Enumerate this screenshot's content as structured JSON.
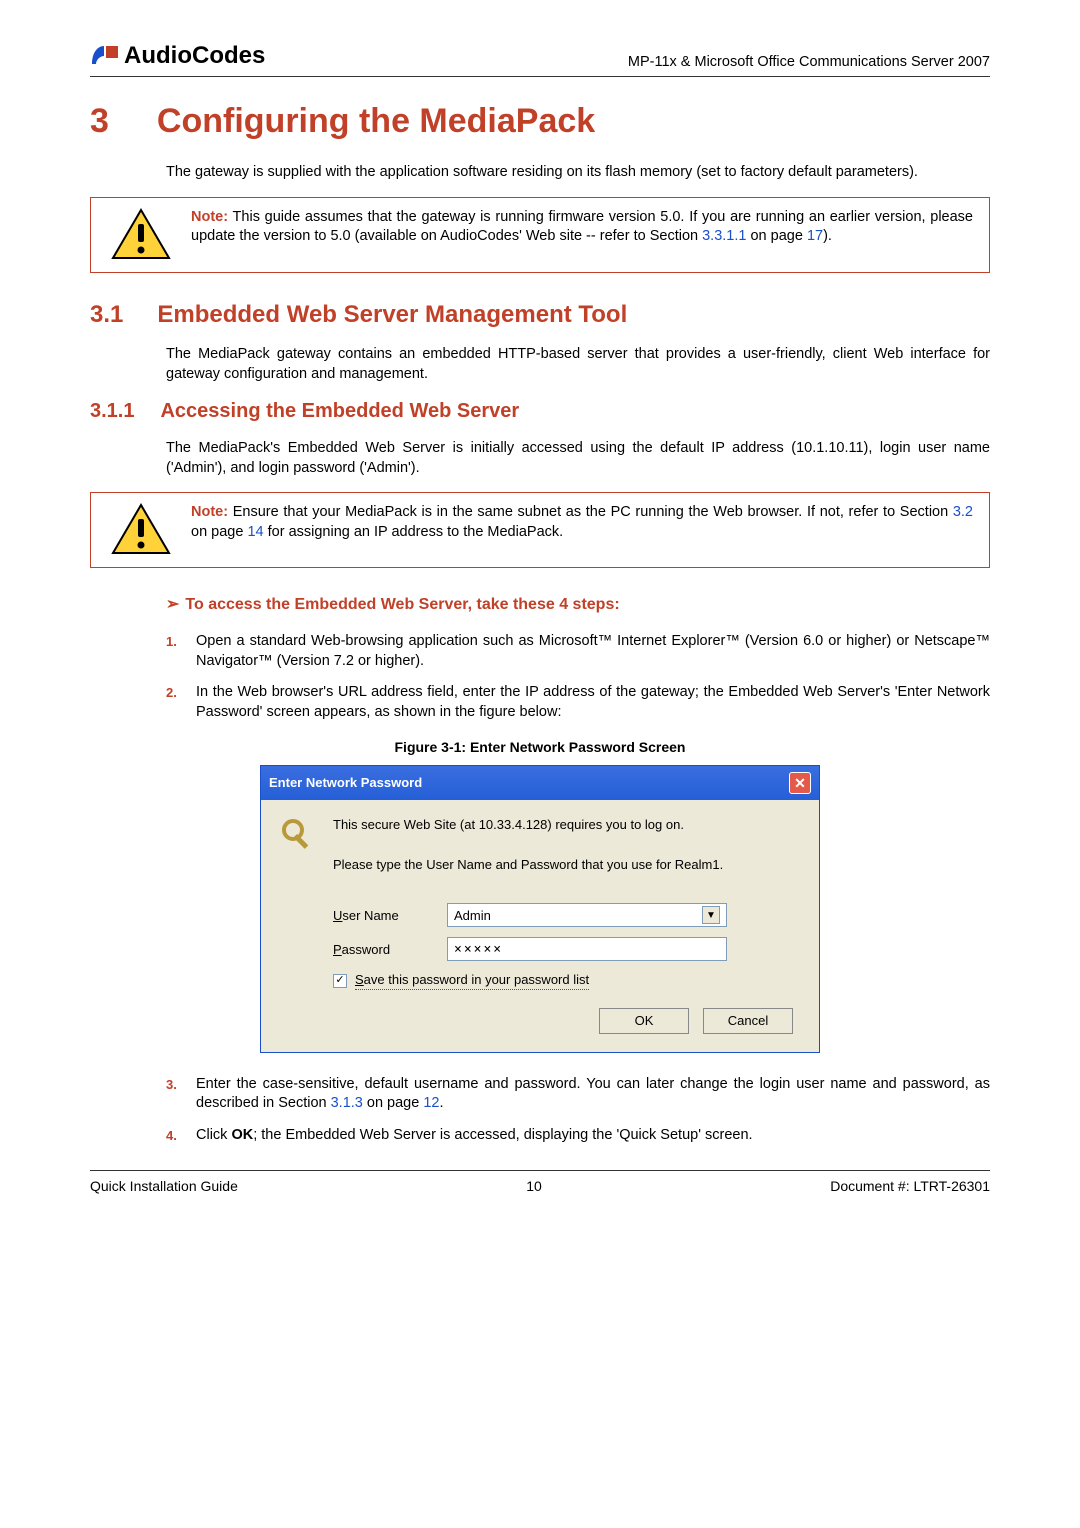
{
  "header": {
    "brand_prefix": "Audio",
    "brand_suffix": "Codes",
    "right": "MP-11x & Microsoft Office Communications Server 2007"
  },
  "h1": {
    "num": "3",
    "title": "Configuring the MediaPack"
  },
  "intro": "The gateway is supplied with the application software residing on its flash memory (set to factory default parameters).",
  "note1": {
    "label": "Note:",
    "text_a": "This guide assumes that the gateway is running firmware version 5.0. If you are running an earlier version, please update the version to 5.0 (available on AudioCodes' Web site -- refer to Section ",
    "ref1": "3.3.1.1",
    "text_b": " on page ",
    "ref2": "17",
    "text_c": ")."
  },
  "h2": {
    "num": "3.1",
    "title": "Embedded Web Server Management Tool"
  },
  "p2": "The MediaPack gateway contains an embedded HTTP-based server that provides a user-friendly, client Web interface for gateway configuration and management.",
  "h3": {
    "num": "3.1.1",
    "title": "Accessing the Embedded Web Server"
  },
  "p3": "The MediaPack's Embedded Web Server is initially accessed using the default IP address (10.1.10.11), login user name ('Admin'), and login password ('Admin').",
  "note2": {
    "label": "Note:",
    "text_a": "Ensure that your MediaPack is in the same subnet as the PC running the Web browser. If not, refer to Section ",
    "ref1": "3.2",
    "text_b": " on page ",
    "ref2": "14",
    "text_c": " for assigning an IP address to the MediaPack."
  },
  "proc_title": "To access the Embedded Web Server, take these 4 steps:",
  "steps": {
    "s1": "Open a standard Web-browsing application such as Microsoft™ Internet Explorer™ (Version 6.0 or higher) or Netscape™ Navigator™ (Version 7.2 or higher).",
    "s2": "In the Web browser's URL address field, enter the IP address of the gateway; the Embedded Web Server's 'Enter Network Password' screen appears, as shown in the figure below:",
    "s3_a": "Enter the case-sensitive, default username and password. You can later change the login user name and password, as described in Section ",
    "s3_ref1": "3.1.3",
    "s3_b": " on page ",
    "s3_ref2": "12",
    "s3_c": ".",
    "s4_a": "Click ",
    "s4_bold": "OK",
    "s4_b": "; the Embedded Web Server is accessed, displaying the 'Quick Setup' screen."
  },
  "figure_caption": "Figure 3-1: Enter Network Password Screen",
  "dialog": {
    "title": "Enter Network Password",
    "msg1": "This secure Web Site (at 10.33.4.128) requires you to log on.",
    "msg2": "Please type the User Name and Password that you use for Realm1.",
    "user_label_u": "U",
    "user_label_rest": "ser Name",
    "user_value": "Admin",
    "pass_label_u": "P",
    "pass_label_rest": "assword",
    "pass_value": "×××××",
    "check_pre": "S",
    "check_rest": "ave this password in your password list",
    "ok": "OK",
    "cancel": "Cancel"
  },
  "footer": {
    "left": "Quick Installation Guide",
    "center": "10",
    "right_label": "Document #",
    "right_val": ": LTRT-26301"
  }
}
